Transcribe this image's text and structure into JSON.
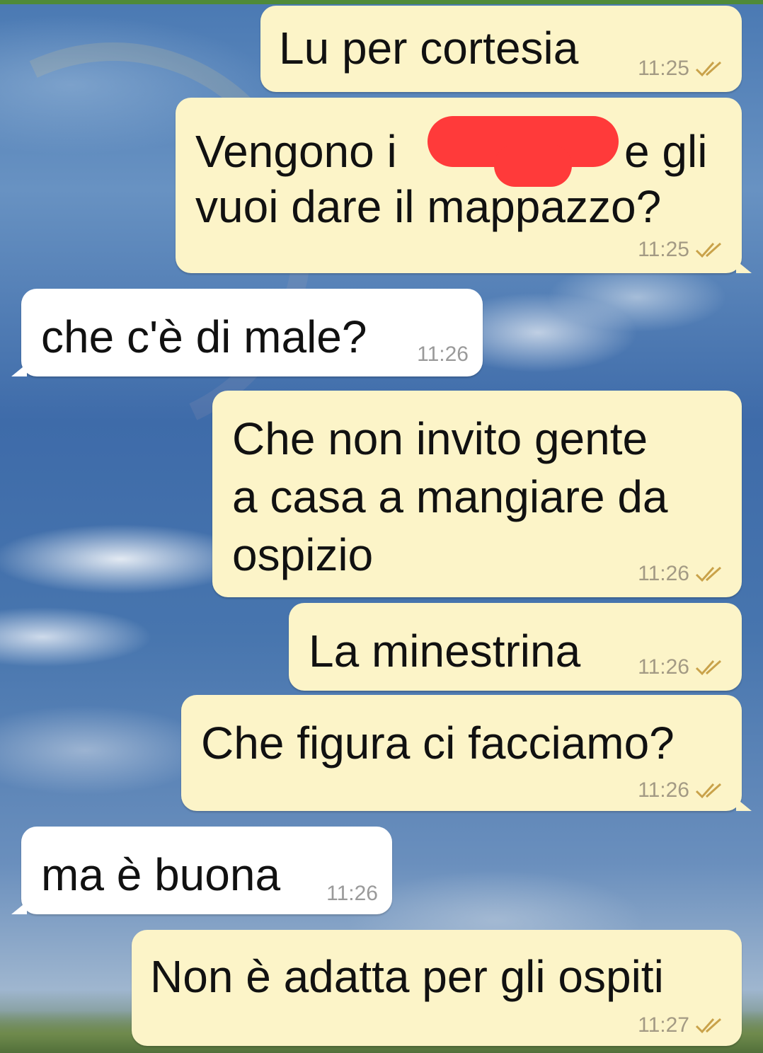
{
  "theme": {
    "outgoing_bubble": "#fcf4c8",
    "incoming_bubble": "#ffffff",
    "redaction_color": "#ff3a3a",
    "check_color": "#c9a24a"
  },
  "messages": [
    {
      "direction": "outgoing",
      "lines": [
        "Lu per cortesia"
      ],
      "time": "11:25",
      "status": "read"
    },
    {
      "direction": "outgoing",
      "lines": [
        "Vengono i",
        "e gli",
        "vuoi dare il mappazzo?"
      ],
      "time": "11:25",
      "status": "read",
      "redacted": true
    },
    {
      "direction": "incoming",
      "lines": [
        "che c'è di male?"
      ],
      "time": "11:26"
    },
    {
      "direction": "outgoing",
      "lines": [
        "Che non invito gente",
        "a casa a mangiare da",
        "ospizio"
      ],
      "time": "11:26",
      "status": "read"
    },
    {
      "direction": "outgoing",
      "lines": [
        "La minestrina"
      ],
      "time": "11:26",
      "status": "read"
    },
    {
      "direction": "outgoing",
      "lines": [
        "Che figura ci facciamo?"
      ],
      "time": "11:26",
      "status": "read"
    },
    {
      "direction": "incoming",
      "lines": [
        "ma è buona"
      ],
      "time": "11:26"
    },
    {
      "direction": "outgoing",
      "lines": [
        "Non è adatta per gli ospiti"
      ],
      "time": "11:27",
      "status": "read"
    }
  ]
}
